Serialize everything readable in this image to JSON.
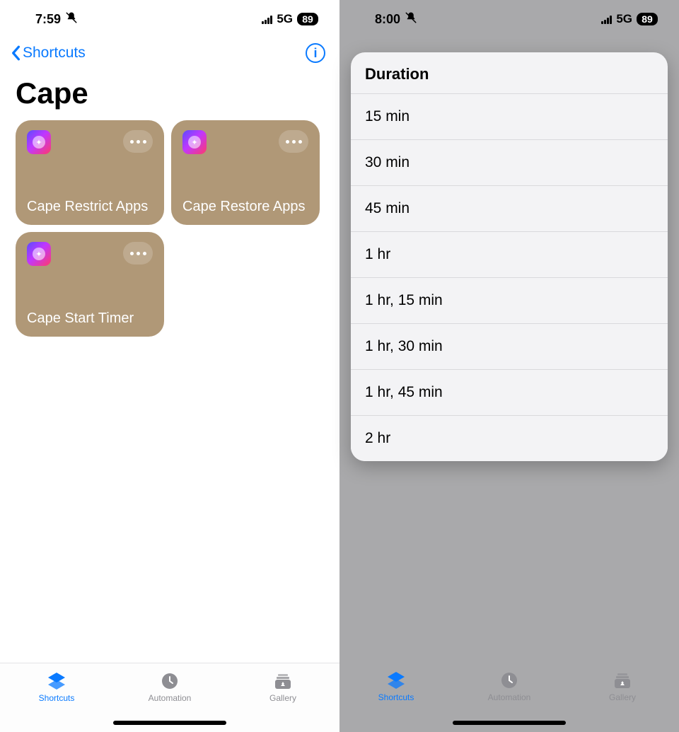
{
  "left": {
    "status": {
      "time": "7:59",
      "network": "5G",
      "battery": "89"
    },
    "nav": {
      "back_label": "Shortcuts"
    },
    "title": "Cape",
    "tiles": [
      {
        "label": "Cape Restrict Apps"
      },
      {
        "label": "Cape Restore Apps"
      },
      {
        "label": "Cape Start Timer"
      }
    ],
    "tabs": {
      "shortcuts": "Shortcuts",
      "automation": "Automation",
      "gallery": "Gallery"
    }
  },
  "right": {
    "status": {
      "time": "8:00",
      "network": "5G",
      "battery": "89"
    },
    "modal": {
      "title": "Duration",
      "options": [
        "15 min",
        "30 min",
        "45 min",
        "1 hr",
        "1 hr, 15 min",
        "1 hr, 30 min",
        "1 hr, 45 min",
        "2 hr"
      ]
    },
    "tabs": {
      "shortcuts": "Shortcuts",
      "automation": "Automation",
      "gallery": "Gallery"
    }
  }
}
